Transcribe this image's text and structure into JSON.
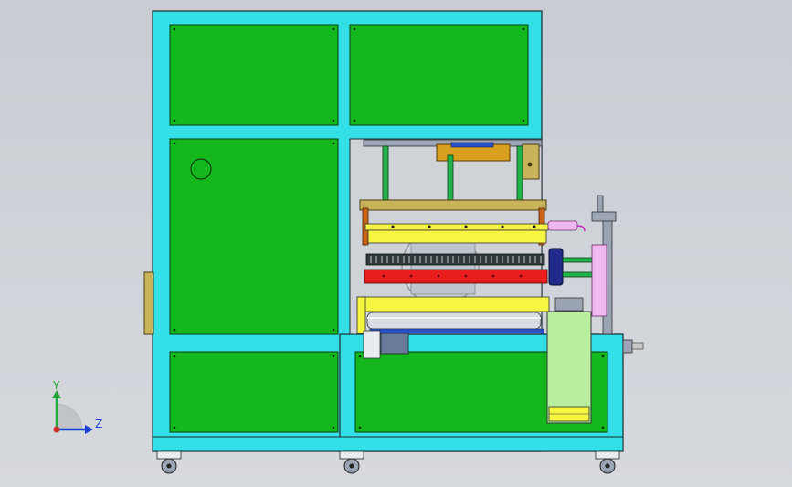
{
  "triad": {
    "y_label": "Y",
    "z_label": "Z",
    "y_color": "#1faa3a",
    "z_color": "#1a3fd6",
    "origin_color": "#d42a2a"
  },
  "colors": {
    "frame": "#33e0e8",
    "panel": "#14b81c",
    "yellow": "#f5f542",
    "red": "#e81e1e",
    "olive": "#c8b35a",
    "light_green": "#b8f0a0",
    "pink": "#f0b8f0",
    "steel": "#9aa4b4",
    "background": "#cfd3d8"
  }
}
